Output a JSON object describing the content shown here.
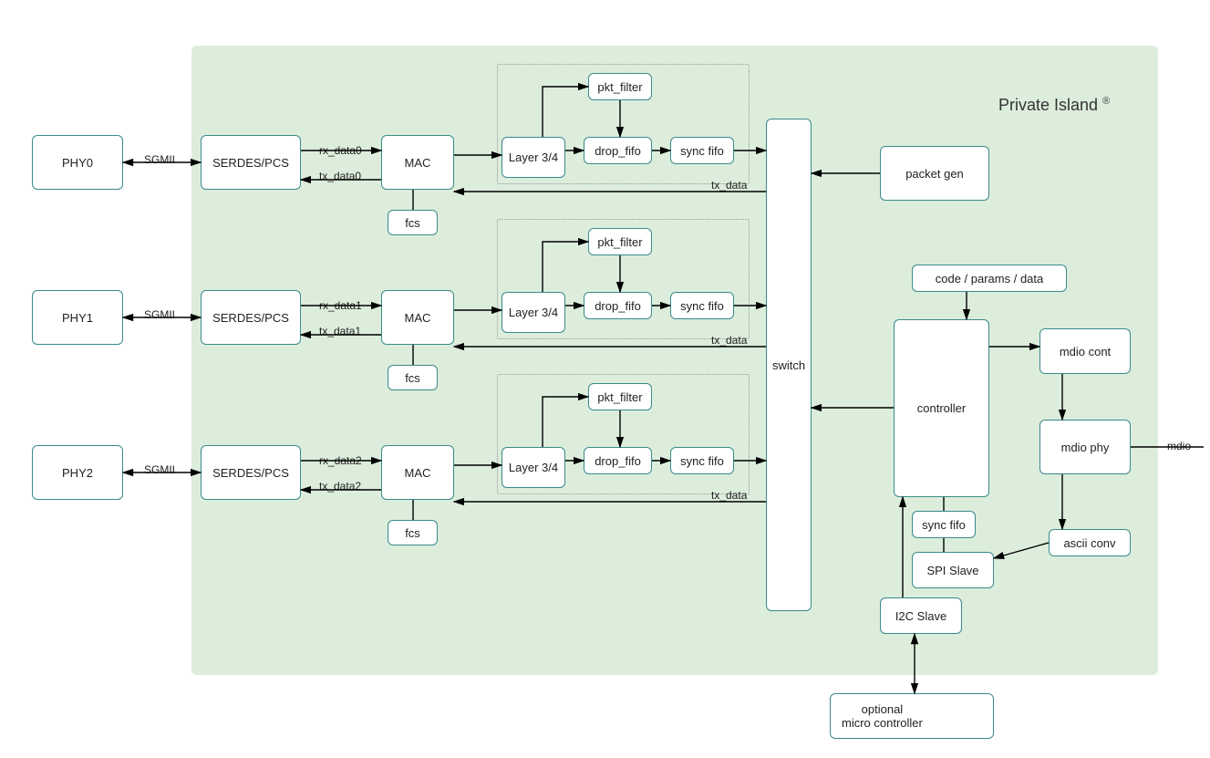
{
  "title": "Private Island",
  "title_reg": "®",
  "external": {
    "mdio": "mdio",
    "micro": "optional\nmicro controller"
  },
  "phy": [
    {
      "name": "PHY0",
      "link": "SGMII",
      "rx": "rx_data0",
      "tx": "tx_data0"
    },
    {
      "name": "PHY1",
      "link": "SGMII",
      "rx": "rx_data1",
      "tx": "tx_data1"
    },
    {
      "name": "PHY2",
      "link": "SGMII",
      "rx": "rx_data2",
      "tx": "tx_data2"
    }
  ],
  "common": {
    "serdes": "SERDES/PCS",
    "mac": "MAC",
    "fcs": "fcs",
    "layer34": "Layer 3/4",
    "pkt_filter": "pkt_filter",
    "drop_fifo": "drop_fifo",
    "sync_fifo": "sync fifo",
    "tx_data": "tx_data"
  },
  "switch": "switch",
  "right": {
    "packet_gen": "packet gen",
    "code_params": "code / params / data",
    "controller": "controller",
    "mdio_cont": "mdio cont",
    "mdio_phy": "mdio phy",
    "ascii_conv": "ascii conv",
    "spi_slave": "SPI Slave",
    "i2c_slave": "I2C Slave",
    "sync_fifo": "sync fifo"
  }
}
